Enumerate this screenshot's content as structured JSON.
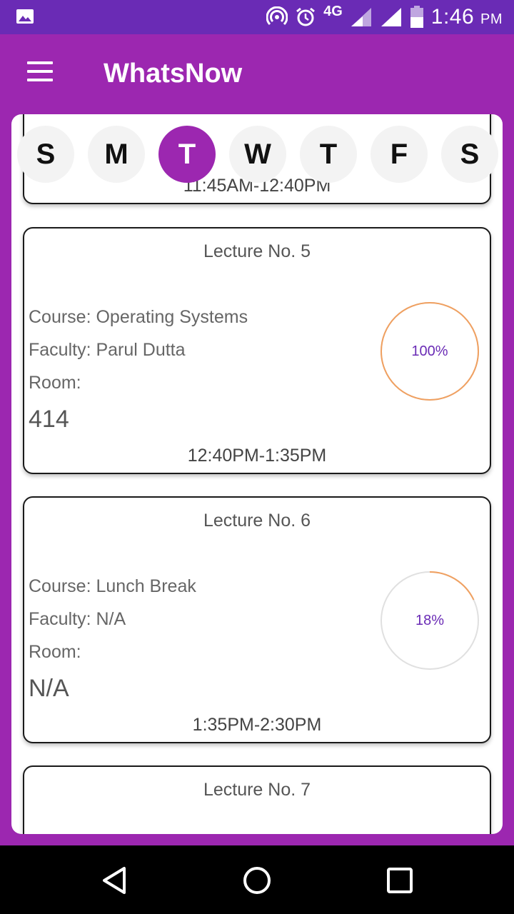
{
  "status_bar": {
    "network": "4G",
    "time": "1:46",
    "ampm": "PM"
  },
  "app_bar": {
    "title": "WhatsNow"
  },
  "days": [
    {
      "label": "S",
      "active": false
    },
    {
      "label": "M",
      "active": false
    },
    {
      "label": "T",
      "active": true
    },
    {
      "label": "W",
      "active": false
    },
    {
      "label": "T",
      "active": false
    },
    {
      "label": "F",
      "active": false
    },
    {
      "label": "S",
      "active": false
    }
  ],
  "lectures": [
    {
      "time": "11:45AM-12:40PM"
    },
    {
      "title": "Lecture No. 5",
      "course": "Course: Operating Systems",
      "faculty": "Faculty: Parul Dutta",
      "room_label": "Room:",
      "room": "414",
      "time": "12:40PM-1:35PM",
      "progress_text": "100%",
      "progress": 1.0
    },
    {
      "title": "Lecture No. 6",
      "course": "Course: Lunch Break",
      "faculty": "Faculty: N/A",
      "room_label": "Room:",
      "room": "N/A",
      "time": "1:35PM-2:30PM",
      "progress_text": "18%",
      "progress": 0.18
    },
    {
      "title": "Lecture No. 7"
    }
  ],
  "colors": {
    "primary": "#9c27b0",
    "status_bar": "#6a2bb5",
    "progress_ring": "#f0a060",
    "ring_track": "#e0e0e0"
  }
}
